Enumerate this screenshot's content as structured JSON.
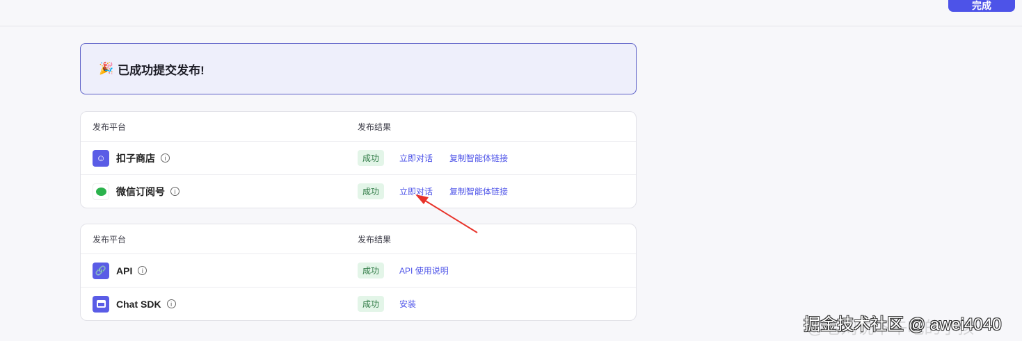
{
  "header": {
    "done_label": "完成"
  },
  "banner": {
    "icon": "party-popper",
    "text": "已成功提交发布!"
  },
  "tables": [
    {
      "headers": [
        "发布平台",
        "发布结果"
      ],
      "rows": [
        {
          "platform": "扣子商店",
          "icon": "coze-store-icon",
          "status": "成功",
          "links": [
            "立即对话",
            "复制智能体链接"
          ]
        },
        {
          "platform": "微信订阅号",
          "icon": "wechat-icon",
          "status": "成功",
          "links": [
            "立即对话",
            "复制智能体链接"
          ]
        }
      ]
    },
    {
      "headers": [
        "发布平台",
        "发布结果"
      ],
      "rows": [
        {
          "platform": "API",
          "icon": "api-link-icon",
          "status": "成功",
          "links": [
            "API 使用说明"
          ]
        },
        {
          "platform": "Chat SDK",
          "icon": "sdk-window-icon",
          "status": "成功",
          "links": [
            "安装"
          ]
        }
      ]
    }
  ],
  "watermark": {
    "text": "掘金技术社区 @ awei4040",
    "faint_text": "@老刘说下午吃的小孩"
  },
  "colors": {
    "accent": "#4d53e8",
    "success_bg": "#e3f5e8",
    "success_text": "#2f7a45",
    "annotation_arrow": "#e8332a"
  }
}
